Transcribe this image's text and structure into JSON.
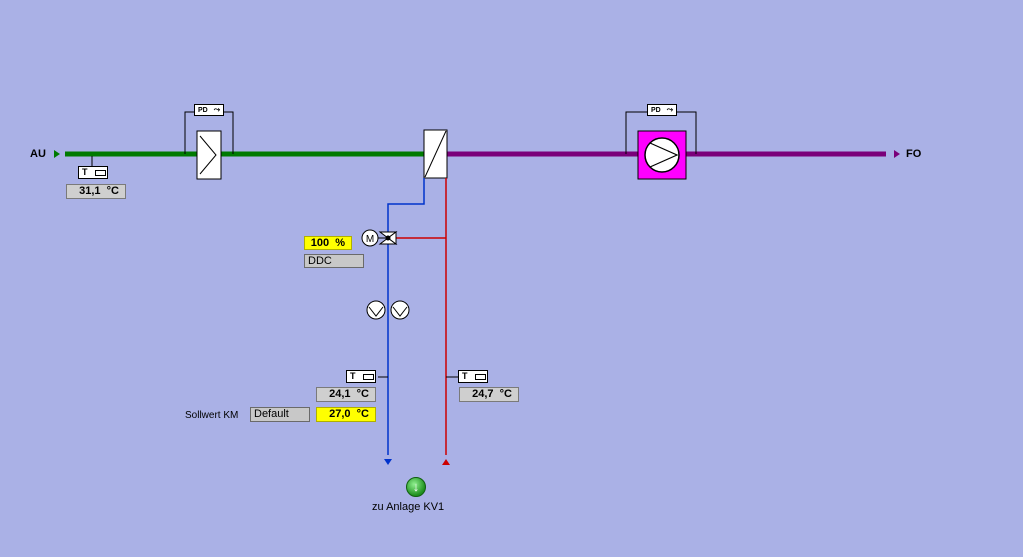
{
  "inlet": {
    "label": "AU"
  },
  "outlet": {
    "label": "FO"
  },
  "sensors": {
    "outdoor_temp": {
      "tag": "T",
      "value": "31,1",
      "unit": "°C"
    },
    "supply_temp": {
      "tag": "T",
      "value": "24,1",
      "unit": "°C"
    },
    "return_temp": {
      "tag": "T",
      "value": "24,7",
      "unit": "°C"
    }
  },
  "differential_pressure": {
    "filter_tag": "PD",
    "fan_tag": "PD"
  },
  "valve": {
    "motor_label": "M",
    "position": "100",
    "position_unit": "%",
    "mode": "DDC"
  },
  "setpoint": {
    "label": "Sollwert KM",
    "mode": "Default",
    "value": "27,0",
    "unit": "°C"
  },
  "link": {
    "label": "zu Anlage KV1",
    "icon": "arrow-down-circle-icon"
  },
  "colors": {
    "background": "#aab1e6",
    "outdoor_air_duct": "#007a00",
    "exhaust_duct": "#7a007a",
    "supply_water": "#0033cc",
    "return_water": "#cc0000",
    "fan_housing": "#ff00ff"
  }
}
